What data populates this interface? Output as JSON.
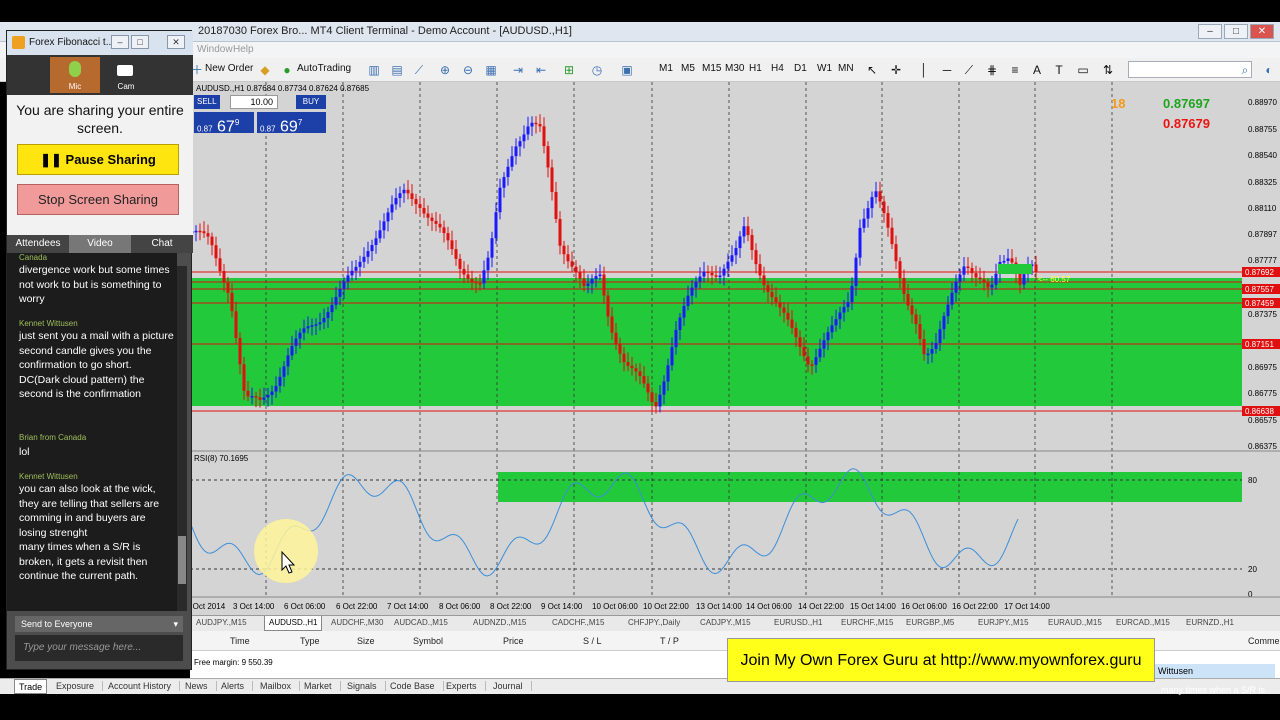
{
  "window": {
    "title": "20187030 Forex Bro... MT4 Client Terminal - Demo Account - [AUDUSD.,H1]",
    "menu": [
      "Window",
      "Help"
    ]
  },
  "toolbar": {
    "new_order": "New Order",
    "autotrading": "AutoTrading",
    "timeframes": [
      "M1",
      "M5",
      "M15",
      "M30",
      "H1",
      "H4",
      "D1",
      "W1",
      "MN"
    ]
  },
  "chart": {
    "symbol_header": "AUDUSD.,H1  0.87684 0.87734 0.87624 0.87685",
    "one_click": {
      "sell_label": "SELL",
      "lot": "10.00",
      "buy_label": "BUY",
      "sell_price_prefix": "0.87",
      "sell_price_big": "67",
      "sell_price_sup": "9",
      "buy_price_prefix": "0.87",
      "buy_price_big": "69",
      "buy_price_sup": "7"
    },
    "spread": "18",
    "ask": "0.87697",
    "bid": "0.87679",
    "price_axis": [
      "0.88970",
      "0.88755",
      "0.88540",
      "0.88325",
      "0.88110",
      "0.87897",
      "0.87777",
      "0.87557",
      "0.87459",
      "0.87375",
      "0.87151",
      "0.86975",
      "0.86775",
      "0.86638",
      "0.86575",
      "0.86375"
    ],
    "price_tags": [
      "0.87692",
      "0.87557",
      "0.87459",
      "0.87151",
      "0.86638"
    ],
    "rsi_label": "RSI(8) 70.1695",
    "rsi_axis": [
      "80",
      "20",
      "0"
    ],
    "time_axis": [
      "2 Oct 2014",
      "3 Oct 14:00",
      "6 Oct 06:00",
      "6 Oct 22:00",
      "7 Oct 14:00",
      "8 Oct 06:00",
      "8 Oct 22:00",
      "9 Oct 14:00",
      "10 Oct 06:00",
      "10 Oct 22:00",
      "13 Oct 14:00",
      "14 Oct 06:00",
      "14 Oct 22:00",
      "15 Oct 14:00",
      "16 Oct 06:00",
      "16 Oct 22:00",
      "17 Oct 14:00"
    ],
    "marker_text": "<-- 60.57",
    "colors": {
      "bull": "#1a1aff",
      "bear": "#e01010",
      "zone": "#22c93a",
      "rsi": "#3d8ed8",
      "level": "#e01010"
    }
  },
  "symbol_tabs": [
    "AUDJPY.,M15",
    "AUDUSD.,H1",
    "AUDCHF.,M30",
    "AUDCAD.,M15",
    "AUDNZD.,M15",
    "CADCHF.,M15",
    "CHFJPY.,Daily",
    "CADJPY.,M15",
    "EURUSD.,H1",
    "EURCHF.,M15",
    "EURGBP.,M5",
    "EURJPY.,M15",
    "EURAUD.,M15",
    "EURCAD.,M15",
    "EURNZD.,H1"
  ],
  "terminal": {
    "columns": [
      "Time",
      "Type",
      "Size",
      "Symbol",
      "Price",
      "S / L",
      "T / P",
      "Comment"
    ],
    "free_margin": "Free margin: 9 550.39",
    "tabs": [
      "Trade",
      "Exposure",
      "Account History",
      "News",
      "Alerts",
      "Mailbox",
      "Market",
      "Signals",
      "Code Base",
      "Experts",
      "Journal"
    ]
  },
  "banner": "Join My Own Forex Guru at http://www.myownforex.guru",
  "notification": {
    "name": "Wittusen",
    "preview": "many times when a S/R is"
  },
  "share_panel": {
    "title": "Forex Fibonacci t...",
    "mic": "Mic",
    "cam": "Cam",
    "sharing_msg": "You are sharing your entire screen.",
    "pause": "Pause Sharing",
    "stop": "Stop Screen Sharing",
    "tabs": [
      "Attendees",
      "Video",
      "Chat"
    ],
    "chat": [
      {
        "sender": "Canada",
        "text": "divergence work but some times not work to but is something to worry"
      },
      {
        "sender": "Kennet Wittusen",
        "text": "just sent you a mail with a picture\nsecond candle gives you the confirmation to go short.\nDC(Dark cloud pattern) the second is the confirmation"
      },
      {
        "sender": "Brian from Canada",
        "text": "lol"
      },
      {
        "sender": "Kennet Wittusen",
        "text": "you can also look at the wick, they are telling that sellers are comming in and buyers are losing strenght\nmany times when a S/R is broken, it gets a revisit then continue the current path."
      }
    ],
    "send_to": "Send to Everyone",
    "type_placeholder": "Type your message here..."
  }
}
